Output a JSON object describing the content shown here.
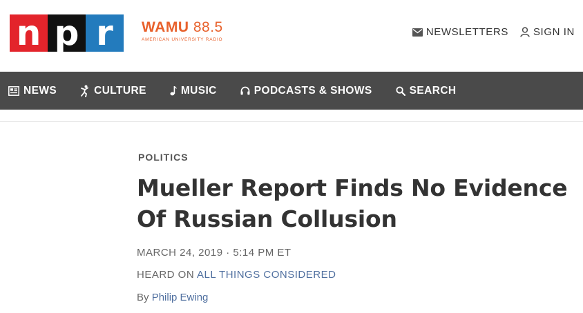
{
  "brand": {
    "logo_letters": [
      "n",
      "p",
      "r"
    ],
    "station_name_bold": "WAMU",
    "station_frequency": "88.5",
    "station_subtitle": "AMERICAN UNIVERSITY RADIO"
  },
  "utility": {
    "newsletters_label": "NEWSLETTERS",
    "signin_label": "SIGN IN"
  },
  "nav": {
    "items": [
      {
        "label": "NEWS",
        "icon": "news-icon"
      },
      {
        "label": "CULTURE",
        "icon": "culture-icon"
      },
      {
        "label": "MUSIC",
        "icon": "music-note-icon"
      },
      {
        "label": "PODCASTS & SHOWS",
        "icon": "headphones-icon"
      },
      {
        "label": "SEARCH",
        "icon": "search-icon"
      }
    ]
  },
  "story": {
    "slug": "POLITICS",
    "headline": "Mueller Report Finds No Evidence Of Russian Collusion",
    "date": "MARCH 24, 2019 · 5:14 PM ET",
    "heard_on_prefix": "HEARD ON",
    "heard_on_program": "ALL THINGS CONSIDERED",
    "byline_prefix": "By",
    "author": "Philip Ewing"
  },
  "colors": {
    "npr_red": "#e3242b",
    "npr_black": "#111111",
    "npr_blue": "#237bbd",
    "station_orange": "#e8612c",
    "nav_bg": "#4a4a4a",
    "link": "#4f6f9f"
  }
}
